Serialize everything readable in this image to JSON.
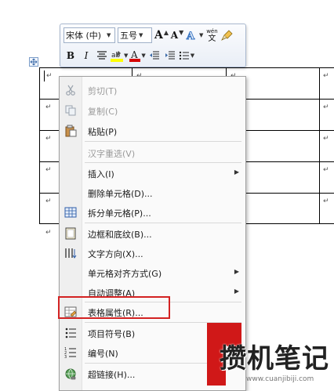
{
  "mini_toolbar": {
    "font_name": "宋体 (中)",
    "font_size": "五号",
    "grow_font": "A",
    "shrink_font": "A",
    "phonetic": "wén",
    "bold": "B",
    "italic": "I",
    "font_color_glyph": "A"
  },
  "document": {
    "paragraph_mark": "↵"
  },
  "context_menu": {
    "items": [
      {
        "label": "剪切(T)",
        "disabled": true,
        "icon": "scissors-icon"
      },
      {
        "label": "复制(C)",
        "disabled": true,
        "icon": "copy-icon"
      },
      {
        "label": "粘贴(P)",
        "disabled": false,
        "icon": "paste-icon"
      },
      {
        "label": "汉字重选(V)",
        "disabled": true,
        "icon": ""
      },
      {
        "label": "插入(I)",
        "disabled": false,
        "submenu": true,
        "icon": ""
      },
      {
        "label": "删除单元格(D)...",
        "disabled": false,
        "icon": ""
      },
      {
        "label": "拆分单元格(P)...",
        "disabled": false,
        "icon": "split-cells-icon"
      },
      {
        "label": "边框和底纹(B)...",
        "disabled": false,
        "icon": "borders-icon"
      },
      {
        "label": "文字方向(X)...",
        "disabled": false,
        "icon": "text-direction-icon"
      },
      {
        "label": "单元格对齐方式(G)",
        "disabled": false,
        "submenu": true,
        "icon": ""
      },
      {
        "label": "自动调整(A)",
        "disabled": false,
        "submenu": true,
        "icon": ""
      },
      {
        "label": "表格属性(R)...",
        "disabled": false,
        "icon": "table-properties-icon"
      },
      {
        "label": "项目符号(B)",
        "disabled": false,
        "submenu": true,
        "icon": "bullets-icon"
      },
      {
        "label": "编号(N)",
        "disabled": false,
        "submenu": true,
        "icon": "numbering-icon"
      },
      {
        "label": "超链接(H)...",
        "disabled": false,
        "icon": "hyperlink-icon"
      }
    ],
    "submenu_arrow": "▶"
  },
  "watermark": {
    "text": "攒机笔记",
    "url": "www.cuanjibiji.com"
  },
  "colors": {
    "highlight": "#d32222",
    "font_color_bar": "#d40000",
    "highlighter_bar": "#ffff00"
  }
}
